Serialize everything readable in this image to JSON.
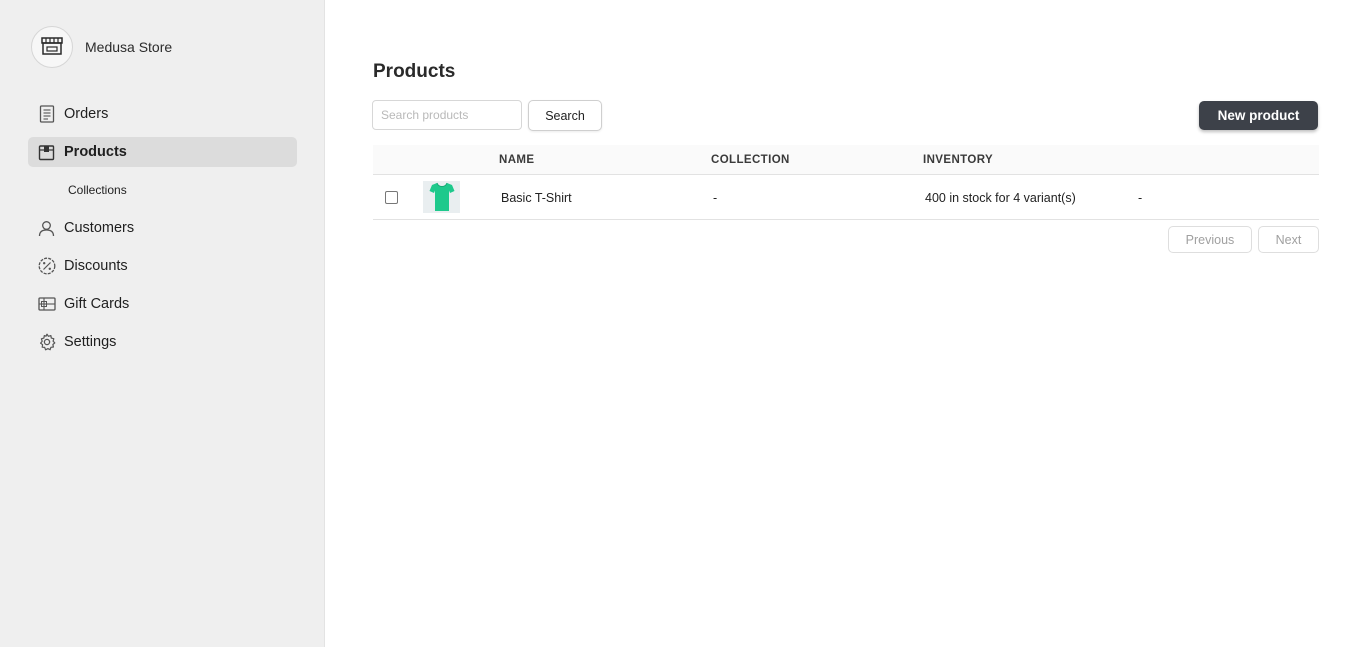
{
  "sidebar": {
    "store_name": "Medusa Store",
    "items": [
      {
        "label": "Orders",
        "icon": "receipt-icon"
      },
      {
        "label": "Products",
        "icon": "box-icon",
        "active": true
      },
      {
        "label": "Collections"
      },
      {
        "label": "Customers",
        "icon": "user-icon"
      },
      {
        "label": "Discounts",
        "icon": "percent-icon"
      },
      {
        "label": "Gift Cards",
        "icon": "gift-card-icon"
      },
      {
        "label": "Settings",
        "icon": "gear-icon"
      }
    ]
  },
  "main": {
    "title": "Products",
    "search": {
      "placeholder": "Search products",
      "button": "Search"
    },
    "new_product_label": "New product",
    "table": {
      "headers": [
        "NAME",
        "COLLECTION",
        "INVENTORY"
      ],
      "rows": [
        {
          "name": "Basic T-Shirt",
          "collection": "-",
          "inventory": "400 in stock for 4 variant(s)",
          "extra": "-"
        }
      ]
    },
    "pagination": {
      "previous": "Previous",
      "next": "Next"
    }
  },
  "colors": {
    "sidebar_bg": "#efefef",
    "active_item_bg": "#dcdcdc",
    "primary_button": "#3d4149",
    "tshirt": "#1ec98c"
  }
}
